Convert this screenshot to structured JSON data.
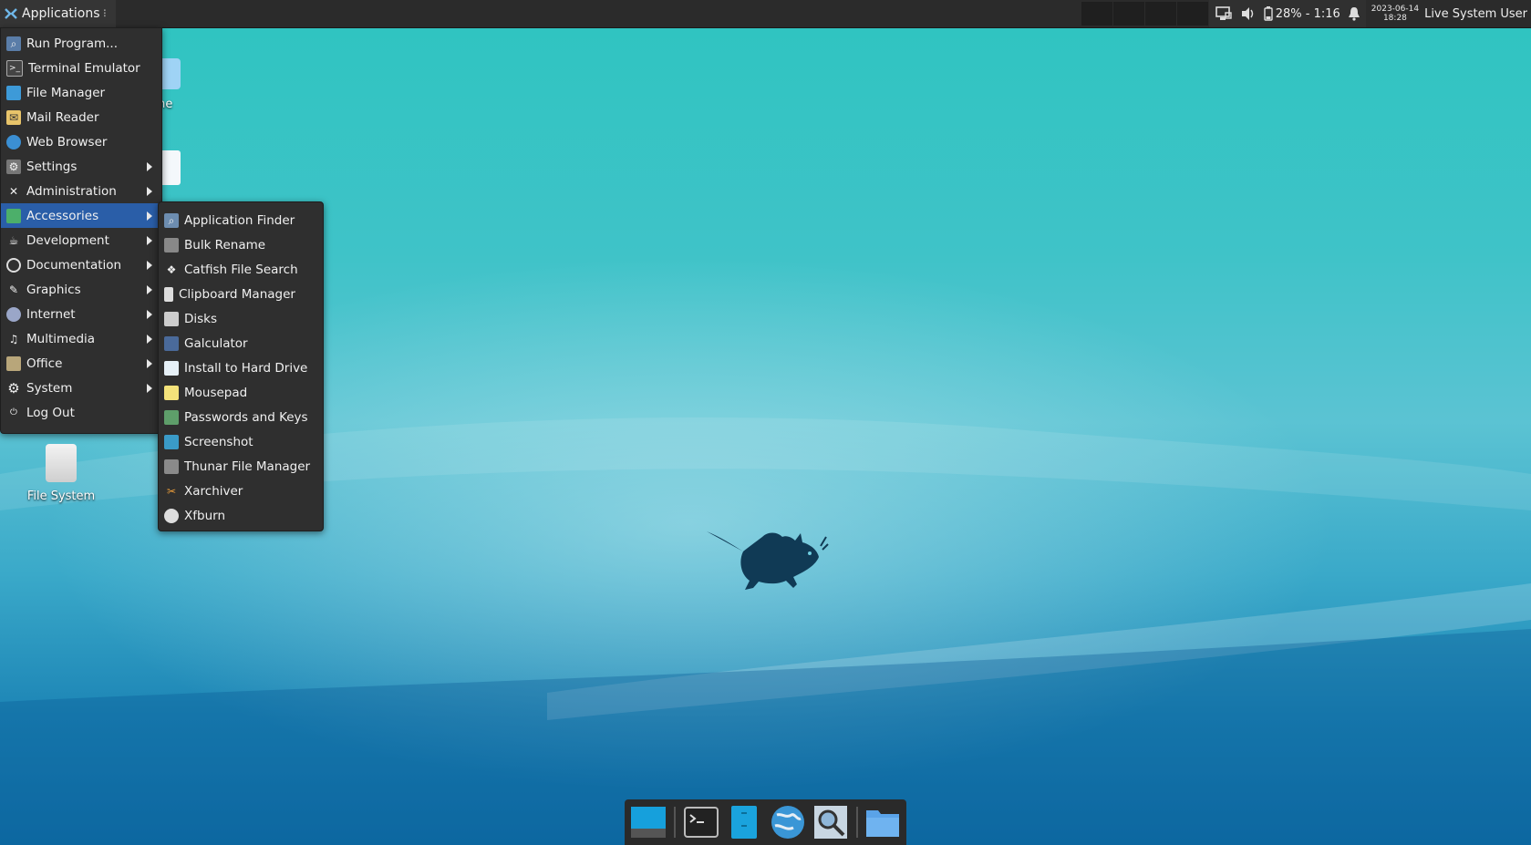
{
  "top_panel": {
    "applications_label": "Applications",
    "handle": "⠇",
    "battery": "28% - 1:16",
    "clock_date": "2023-06-14",
    "clock_time": "18:28",
    "user": "Live System User"
  },
  "desktop": {
    "home_label": "me",
    "filesystem_label": "File System"
  },
  "apps_menu": {
    "items": [
      {
        "label": "Run Program..."
      },
      {
        "label": "Terminal Emulator"
      },
      {
        "label": "File Manager"
      },
      {
        "label": "Mail Reader"
      },
      {
        "label": "Web Browser"
      },
      {
        "label": "Settings"
      },
      {
        "label": "Administration"
      },
      {
        "label": "Accessories"
      },
      {
        "label": "Development"
      },
      {
        "label": "Documentation"
      },
      {
        "label": "Graphics"
      },
      {
        "label": "Internet"
      },
      {
        "label": "Multimedia"
      },
      {
        "label": "Office"
      },
      {
        "label": "System"
      },
      {
        "label": "Log Out"
      }
    ]
  },
  "accessories_menu": {
    "items": [
      {
        "label": "Application Finder"
      },
      {
        "label": "Bulk Rename"
      },
      {
        "label": "Catfish File Search"
      },
      {
        "label": "Clipboard Manager"
      },
      {
        "label": "Disks"
      },
      {
        "label": "Galculator"
      },
      {
        "label": "Install to Hard Drive"
      },
      {
        "label": "Mousepad"
      },
      {
        "label": "Passwords and Keys"
      },
      {
        "label": "Screenshot"
      },
      {
        "label": "Thunar File Manager"
      },
      {
        "label": "Xarchiver"
      },
      {
        "label": "Xfburn"
      }
    ]
  },
  "colors": {
    "panel": "#2b2b2b",
    "menu_bg": "#2f2f2f",
    "active_item": "#2a5ea8"
  }
}
